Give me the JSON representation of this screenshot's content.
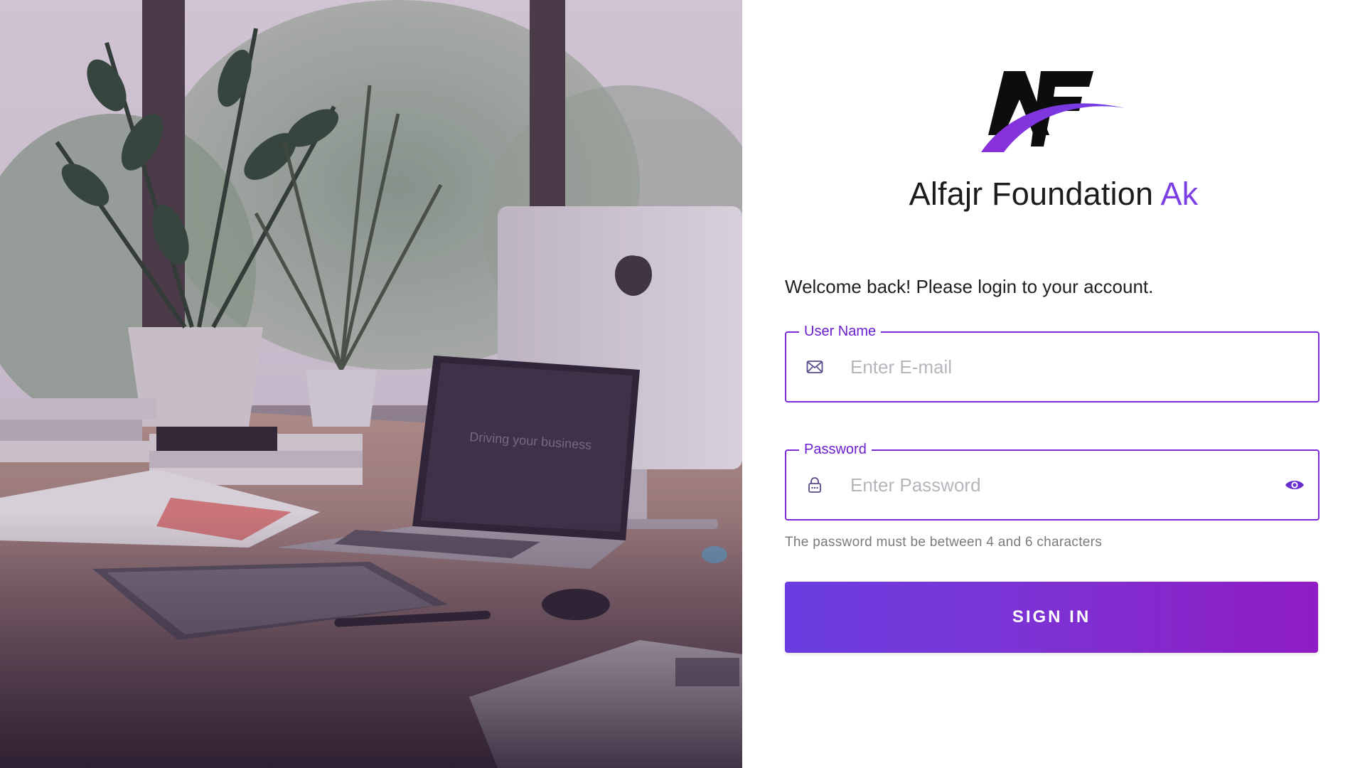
{
  "hero": {
    "laptop_screen_text": "Driving your business"
  },
  "brand": {
    "logo_text": "AF",
    "name": "Alfajr Foundation",
    "name_accent": "Ak"
  },
  "login": {
    "welcome": "Welcome back! Please login to your account.",
    "username": {
      "label": "User Name",
      "placeholder": "Enter E-mail",
      "value": "",
      "icon": "mail-icon"
    },
    "password": {
      "label": "Password",
      "placeholder": "Enter Password",
      "value": "",
      "icon": "lock-icon",
      "toggle_icon": "eye-icon",
      "hint": "The password must be between 4 and 6 characters"
    },
    "submit_label": "SIGN IN"
  },
  "colors": {
    "accent": "#7a2bd6",
    "label": "#6a1fd0",
    "button_gradient_start": "#6a3de0",
    "button_gradient_end": "#8f1cc4",
    "placeholder": "#b7b4bc"
  }
}
